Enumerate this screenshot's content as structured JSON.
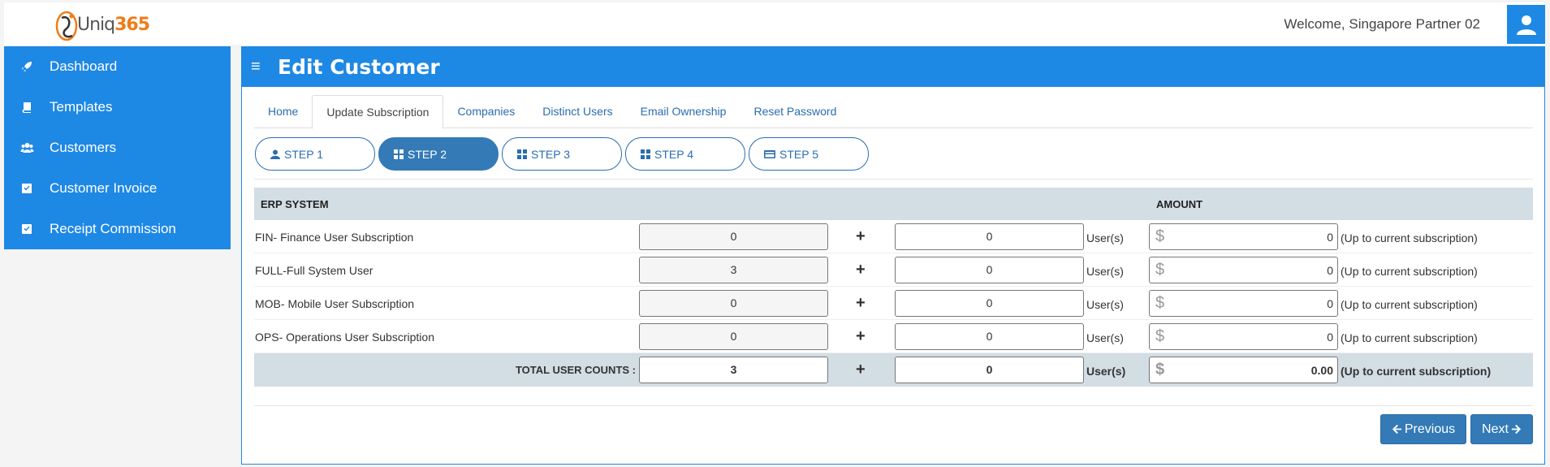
{
  "header": {
    "logo_text_a": "Uniq",
    "logo_text_b": "365",
    "welcome": "Welcome, Singapore Partner 02"
  },
  "sidebar": {
    "items": [
      {
        "label": "Dashboard",
        "icon": "rocket-icon"
      },
      {
        "label": "Templates",
        "icon": "book-icon"
      },
      {
        "label": "Customers",
        "icon": "users-icon"
      },
      {
        "label": "Customer Invoice",
        "icon": "check-square-icon"
      },
      {
        "label": "Receipt Commission",
        "icon": "check-square-icon"
      }
    ]
  },
  "page": {
    "title": "Edit Customer"
  },
  "tabs": [
    {
      "label": "Home"
    },
    {
      "label": "Update Subscription",
      "active": true
    },
    {
      "label": "Companies"
    },
    {
      "label": "Distinct Users"
    },
    {
      "label": "Email Ownership"
    },
    {
      "label": "Reset Password"
    }
  ],
  "steps": [
    {
      "label": "STEP 1",
      "icon": "user-icon"
    },
    {
      "label": "STEP 2",
      "icon": "grid-icon",
      "active": true
    },
    {
      "label": "STEP 3",
      "icon": "grid-icon"
    },
    {
      "label": "STEP 4",
      "icon": "grid-icon"
    },
    {
      "label": "STEP 5",
      "icon": "credit-card-icon"
    }
  ],
  "table": {
    "col_erp": "ERP SYSTEM",
    "col_amount": "AMOUNT",
    "plus": "+",
    "users_label": "User(s)",
    "currency": "$",
    "note": "(Up to current subscription)",
    "rows": [
      {
        "name": "FIN- Finance User Subscription",
        "current": "0",
        "add": "0",
        "amount": "0"
      },
      {
        "name": "FULL-Full System User",
        "current": "3",
        "add": "0",
        "amount": "0"
      },
      {
        "name": "MOB- Mobile User Subscription",
        "current": "0",
        "add": "0",
        "amount": "0"
      },
      {
        "name": "OPS- Operations User Subscription",
        "current": "0",
        "add": "0",
        "amount": "0"
      }
    ],
    "total": {
      "label": "TOTAL USER COUNTS :",
      "current": "3",
      "add": "0",
      "amount": "0.00"
    }
  },
  "buttons": {
    "previous": "Previous",
    "next": "Next"
  },
  "colors": {
    "accent": "#1e88e5",
    "button": "#337ab7",
    "logo_orange": "#f07c18"
  }
}
